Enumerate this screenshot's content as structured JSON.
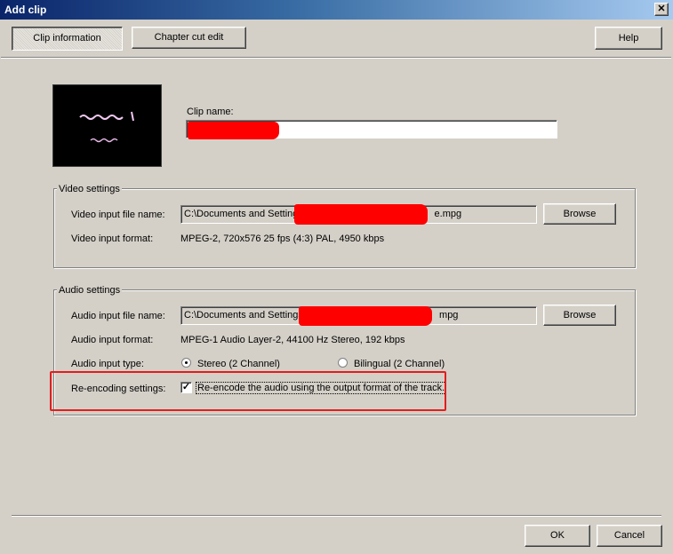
{
  "window": {
    "title": "Add clip",
    "close_glyph": "✕"
  },
  "toolbar": {
    "tab_clip_info": "Clip information",
    "tab_chapter_cut": "Chapter cut edit",
    "help": "Help"
  },
  "clip": {
    "name_label": "Clip name:",
    "name_value": ""
  },
  "video": {
    "group_title": "Video settings",
    "file_label": "Video input file name:",
    "file_prefix": "C:\\Documents and Setting",
    "file_suffix": "e.mpg",
    "browse": "Browse",
    "format_label": "Video input format:",
    "format_value": "MPEG-2, 720x576 25 fps (4:3) PAL, 4950 kbps"
  },
  "audio": {
    "group_title": "Audio settings",
    "file_label": "Audio input file name:",
    "file_prefix": "C:\\Documents and Settings",
    "file_suffix": "mpg",
    "browse": "Browse",
    "format_label": "Audio input format:",
    "format_value": "MPEG-1 Audio Layer-2, 44100 Hz Stereo, 192 kbps",
    "type_label": "Audio input type:",
    "type_stereo": "Stereo (2 Channel)",
    "type_bilingual": "Bilingual (2 Channel)",
    "type_selected": "stereo",
    "reencode_label": "Re-encoding settings:",
    "reencode_checkbox": "Re-encode the audio using the output format of the track.",
    "reencode_checked": true
  },
  "footer": {
    "ok": "OK",
    "cancel": "Cancel"
  },
  "colors": {
    "titlebar_start": "#0a246a",
    "titlebar_end": "#a6caf0",
    "highlight": "#e31d1d",
    "redaction": "#ff0000"
  }
}
